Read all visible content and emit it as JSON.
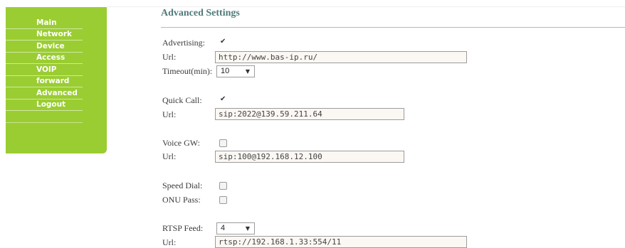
{
  "sidebar": {
    "items": [
      {
        "label": "Main"
      },
      {
        "label": "Network"
      },
      {
        "label": "Device"
      },
      {
        "label": "Access"
      },
      {
        "label": "VOIP"
      },
      {
        "label": "forward"
      },
      {
        "label": "Advanced"
      },
      {
        "label": "Logout"
      }
    ]
  },
  "header": {
    "title": "Advanced Settings"
  },
  "form": {
    "advertising": {
      "label": "Advertising:",
      "checked": true
    },
    "advertising_url": {
      "label": "Url:",
      "value": "http://www.bas-ip.ru/"
    },
    "timeout": {
      "label": "Timeout(min):",
      "value": "10"
    },
    "quick_call": {
      "label": "Quick Call:",
      "checked": true
    },
    "quick_call_url": {
      "label": "Url:",
      "value": "sip:2022@139.59.211.64"
    },
    "voice_gw": {
      "label": "Voice GW:",
      "checked": false
    },
    "voice_gw_url": {
      "label": "Url:",
      "value": "sip:100@192.168.12.100"
    },
    "speed_dial": {
      "label": "Speed Dial:",
      "checked": false
    },
    "onu_pass": {
      "label": "ONU Pass:",
      "checked": false
    },
    "rtsp_feed": {
      "label": "RTSP Feed:",
      "value": "4"
    },
    "rtsp_url": {
      "label": "Url:",
      "value": "rtsp://192.168.1.33:554/11"
    }
  }
}
